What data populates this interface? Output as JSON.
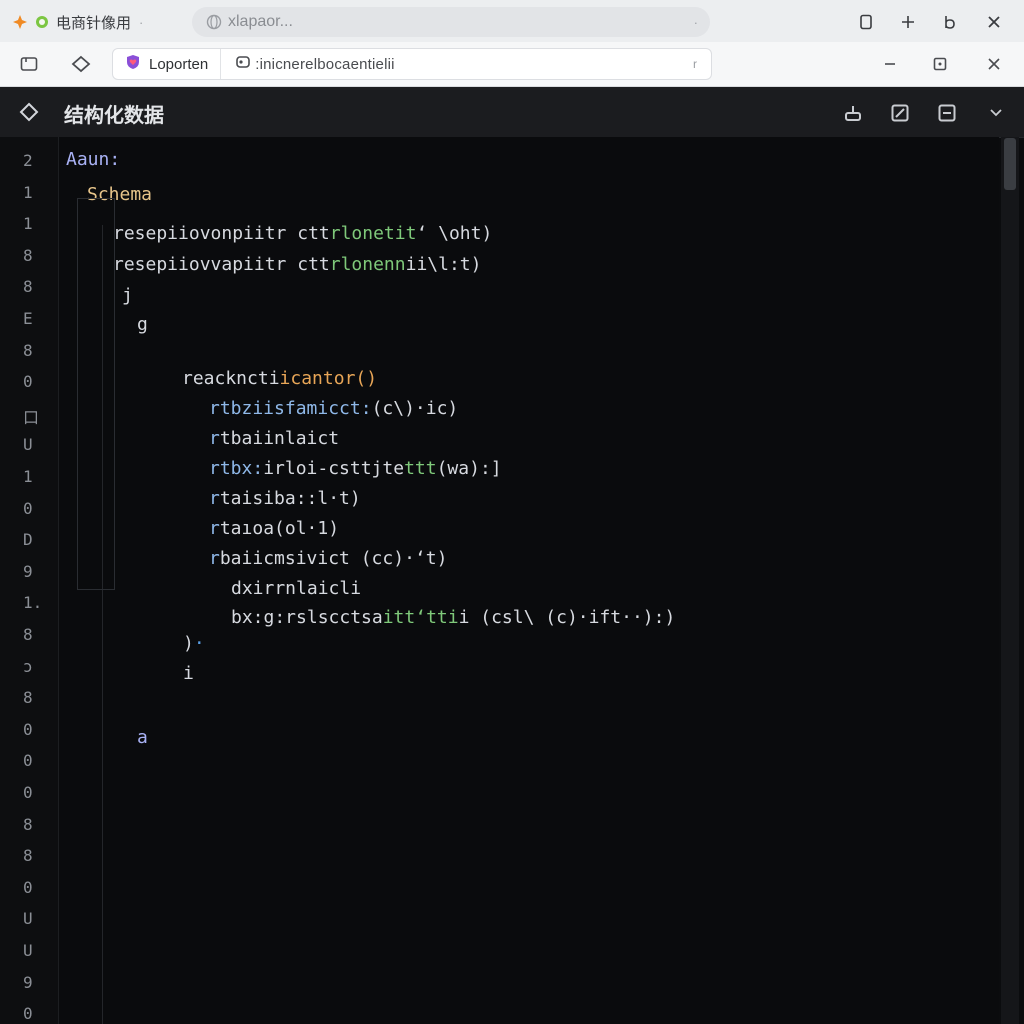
{
  "tabs": [
    {
      "title": "电商针像用",
      "icon": "orange-diamond-icon"
    },
    {
      "title": "xlapaor...",
      "icon": "globe-icon"
    }
  ],
  "address_bar": {
    "site_label": "Loporten",
    "url": ":inicnerelbocaentielii"
  },
  "editor": {
    "title": "结构化数据",
    "line_numbers": [
      "2",
      "1",
      "1",
      "8",
      "8",
      "E",
      "8",
      "0",
      "口",
      "U",
      "1",
      "0",
      "D",
      "9",
      "1.",
      "8",
      "ɔ",
      "8",
      "0",
      "0",
      "0",
      "8",
      "8",
      "0",
      "U",
      "U",
      "9",
      "0"
    ],
    "code_lines": [
      {
        "text": "Aaun:",
        "color": "#a9b2f5",
        "indent": "l0"
      },
      {
        "text": "Schema",
        "color": "#e6c48a",
        "indent": "l1"
      },
      {
        "text": "resepiiovonpiitr ctt",
        "accent": "rlonetit",
        "rest": "‘ \\oht)",
        "color": "#d7dae0",
        "indent": "l2"
      },
      {
        "text": "resepiiovvapiitr ctt",
        "accent": "rlonenn",
        "rest": "ii\\l:t)",
        "color": "#d7dae0",
        "indent": "l2"
      },
      {
        "text": "j",
        "color": "#d7dae0",
        "indent": "l2b"
      },
      {
        "text": "g",
        "color": "#d7dae0",
        "indent": "l3"
      },
      {
        "text": "reackncti",
        "accent": "icantor(",
        "rest": ")",
        "color": "#d7dae0",
        "indent": "l4"
      },
      {
        "text": "rtbziisfamicct:",
        "accent": "(c\\)",
        "rest": "·ic)",
        "color": "#8fb8e8",
        "indent": "l5"
      },
      {
        "text": "r",
        "accent": "tbaiinlaict",
        "rest": "",
        "color": "#8fb8e8",
        "indent": "l5"
      },
      {
        "text": "rtbx:",
        "accent": "irloi",
        "rest": "-csttjte",
        "tail": "ttt",
        "end": "(wa):]",
        "color": "#8fb8e8",
        "indent": "l5"
      },
      {
        "text": "r",
        "accent": "taisiba::l·t)",
        "rest": "",
        "color": "#8fb8e8",
        "indent": "l5"
      },
      {
        "text": "r",
        "accent": "taıoa(ol·1)",
        "rest": "",
        "color": "#8fb8e8",
        "indent": "l5"
      },
      {
        "text": "r",
        "accent": "baiicmsivict (cc)·‘t)",
        "rest": "",
        "color": "#8fb8e8",
        "indent": "l5"
      },
      {
        "text": "dxirrnlaicli",
        "color": "#d7dae0",
        "indent": "l6"
      },
      {
        "text": "bx:g:rslscctsa",
        "accent": "itt‘tti",
        "rest": "i (csl\\ (c)·ift··):)",
        "color": "#d7dae0",
        "indent": "l6"
      },
      {
        "text": ")",
        "accent": "·",
        "rest": "",
        "color": "#d7dae0",
        "indent": "l7"
      },
      {
        "text": "i",
        "color": "#d7dae0",
        "indent": "l7"
      },
      {
        "text": "a",
        "color": "#a9b2f5",
        "indent": "l3"
      }
    ]
  },
  "colors": {
    "background": "#0a0b0d",
    "keyword_orange": "#e8a657",
    "keyword_green": "#7fc97a",
    "keyword_blue": "#5aa0e6",
    "text": "#d7dae0"
  }
}
